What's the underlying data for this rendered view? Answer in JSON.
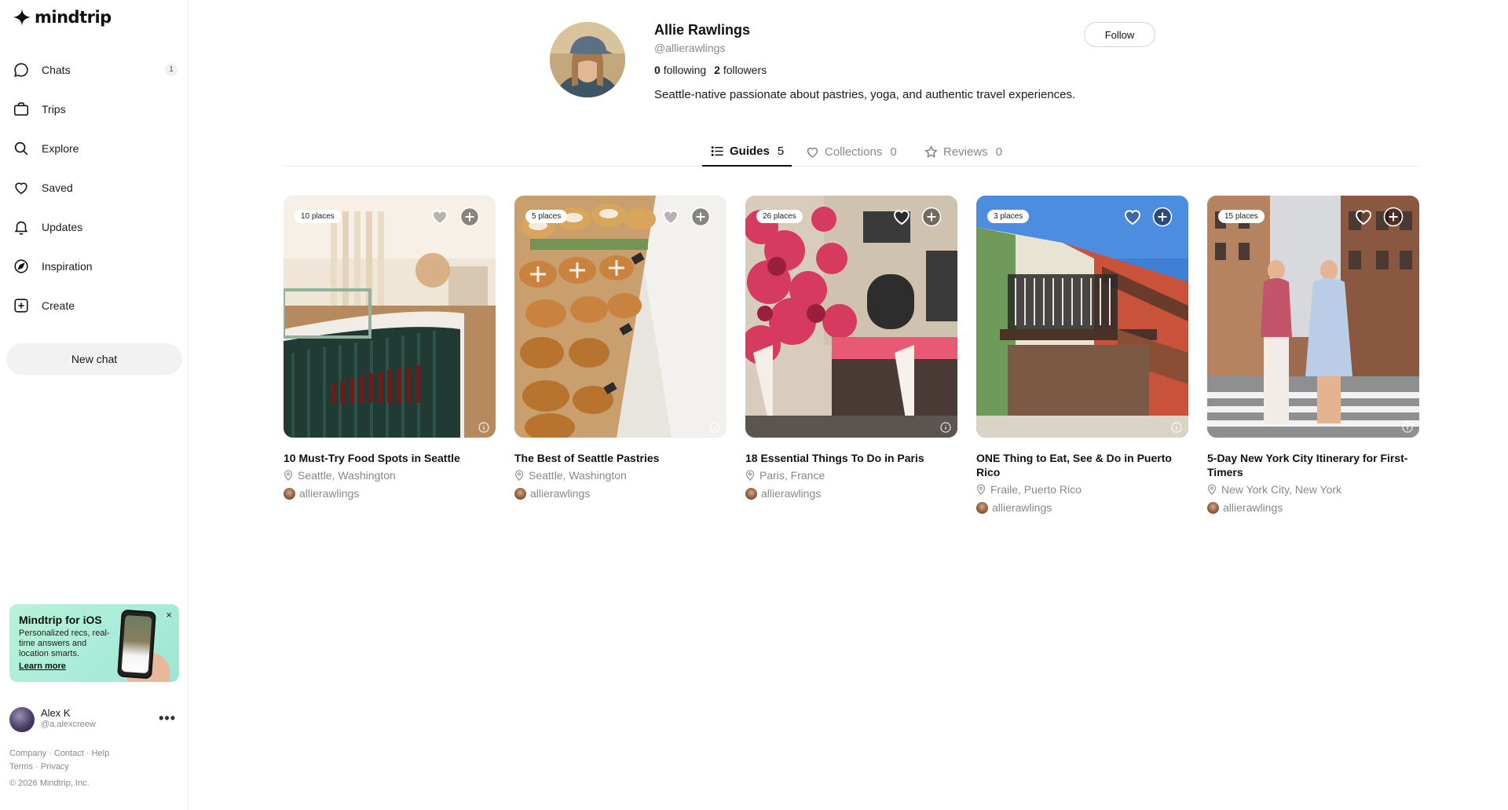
{
  "app": {
    "logo_text": "mindtrip"
  },
  "sidebar": {
    "items": [
      {
        "label": "Chats",
        "icon": "chat-bubble-icon",
        "badge": "1"
      },
      {
        "label": "Trips",
        "icon": "suitcase-icon",
        "badge": ""
      },
      {
        "label": "Explore",
        "icon": "search-icon",
        "badge": ""
      },
      {
        "label": "Saved",
        "icon": "heart-icon",
        "badge": ""
      },
      {
        "label": "Updates",
        "icon": "bell-icon",
        "badge": ""
      },
      {
        "label": "Inspiration",
        "icon": "compass-icon",
        "badge": ""
      },
      {
        "label": "Create",
        "icon": "plus-square-icon",
        "badge": ""
      }
    ],
    "new_chat_label": "New chat",
    "promo": {
      "title": "Mindtrip for iOS",
      "description": "Personalized recs, real-time answers and location smarts.",
      "link": "Learn more",
      "close": "×"
    },
    "user": {
      "name": "Alex K",
      "handle": "@a.alexcreew",
      "more": "•••"
    },
    "footer": {
      "links_row1": [
        "Company",
        "Contact",
        "Help"
      ],
      "links_row2": [
        "Terms",
        "Privacy"
      ],
      "separator": "·",
      "copyright": "© 2026 Mindtrip, Inc."
    }
  },
  "profile": {
    "name": "Allie Rawlings",
    "handle": "@allierawlings",
    "following_count": "0",
    "following_label": "following",
    "followers_count": "2",
    "followers_label": "followers",
    "bio": "Seattle-native passionate about pastries, yoga, and authentic travel experiences.",
    "follow_label": "Follow"
  },
  "tabs": [
    {
      "label": "Guides",
      "count": "5",
      "icon": "list-icon",
      "active": true
    },
    {
      "label": "Collections",
      "count": "0",
      "icon": "heart-icon",
      "active": false
    },
    {
      "label": "Reviews",
      "count": "0",
      "icon": "star-icon",
      "active": false
    }
  ],
  "guides": [
    {
      "places": "10 places",
      "title": "10 Must-Try Food Spots in Seattle",
      "location": "Seattle, Washington",
      "author": "allierawlings"
    },
    {
      "places": "5 places",
      "title": "The Best of Seattle Pastries",
      "location": "Seattle, Washington",
      "author": "allierawlings"
    },
    {
      "places": "26 places",
      "title": "18 Essential Things To Do in Paris",
      "location": "Paris, France",
      "author": "allierawlings"
    },
    {
      "places": "3 places",
      "title": "ONE Thing to Eat, See & Do in Puerto Rico",
      "location": "Fraile, Puerto Rico",
      "author": "allierawlings"
    },
    {
      "places": "15 places",
      "title": "5-Day New York City Itinerary for First-Timers",
      "location": "New York City, New York",
      "author": "allierawlings"
    }
  ]
}
